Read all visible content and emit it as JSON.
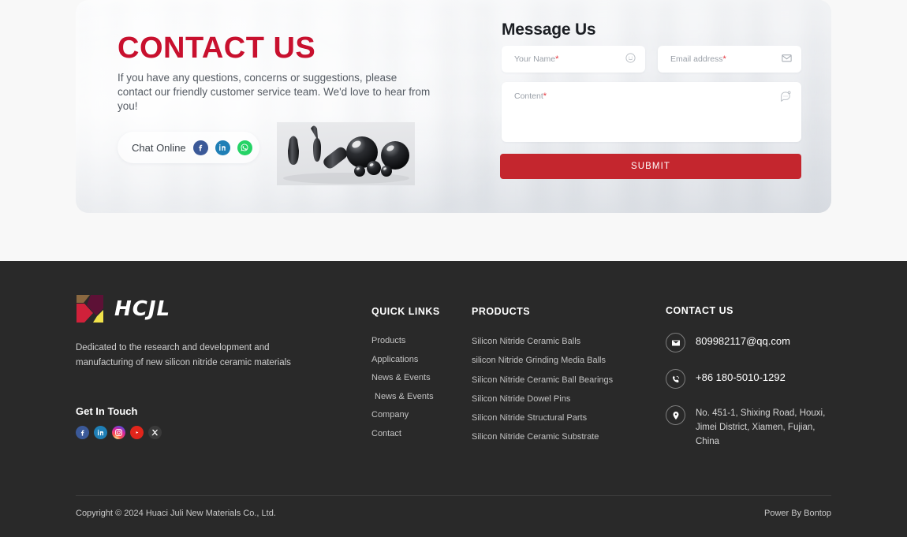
{
  "contact_section": {
    "title": "CONTACT US",
    "subtitle": "If you have any questions, concerns or suggestions, please contact our friendly customer service team. We'd love to hear from you!",
    "chat": {
      "label": "Chat Online",
      "socials": [
        {
          "name": "facebook",
          "color": "#3b5998"
        },
        {
          "name": "linkedin",
          "color": "#1f7fb6"
        },
        {
          "name": "whatsapp",
          "color": "#25d366"
        }
      ]
    },
    "accent_color": "#c8102e"
  },
  "message_form": {
    "title": "Message Us",
    "fields": [
      {
        "placeholder": "Your Name",
        "required_mark": "*",
        "icon": "smiley-icon",
        "value": ""
      },
      {
        "placeholder": "Email address",
        "required_mark": "*",
        "icon": "envelope-icon",
        "value": ""
      },
      {
        "placeholder": "Content",
        "required_mark": "*",
        "icon": "chat-bubble-icon",
        "value": ""
      }
    ],
    "submit_label": "SUBMIT",
    "submit_color": "#c4262e"
  },
  "footer": {
    "brand": {
      "logo_text": "HCJL",
      "logo_colors": [
        "#8a6840",
        "#5d1136",
        "#d0213a",
        "#f2e34a"
      ],
      "description": "Dedicated to the research and development and manufacturing of new silicon nitride ceramic materials",
      "get_in_touch": "Get In Touch",
      "socials": [
        {
          "name": "facebook"
        },
        {
          "name": "linkedin"
        },
        {
          "name": "instagram"
        },
        {
          "name": "youtube"
        },
        {
          "name": "x-twitter"
        }
      ]
    },
    "quick_links": {
      "heading": "QUICK LINKS",
      "items": [
        "Products",
        "Applications",
        "News & Events",
        "News & Events",
        "Company",
        "Contact"
      ]
    },
    "products": {
      "heading": "PRODUCTS",
      "items": [
        "Silicon Nitride Ceramic Balls",
        "silicon Nitride Grinding Media Balls",
        "Silicon Nitride Ceramic Ball Bearings",
        "Silicon Nitride Dowel Pins",
        "Silicon Nitride Structural Parts",
        "Silicon Nitride Ceramic Substrate"
      ]
    },
    "contact": {
      "heading": "CONTACT US",
      "email": "809982117@qq.com",
      "phone": "+86 180-5010-1292",
      "address": "No. 451-1, Shixing Road, Houxi, Jimei District, Xiamen, Fujian, China"
    },
    "bottom": {
      "copyright": "Copyright © 2024  Huaci Juli New Materials Co., Ltd.",
      "powered_by": "Power By Bontop"
    }
  }
}
